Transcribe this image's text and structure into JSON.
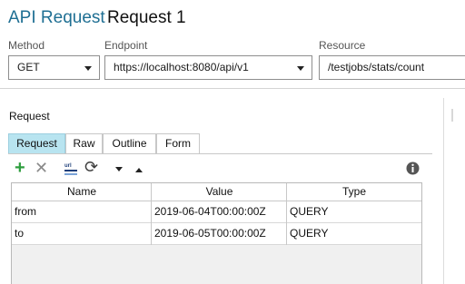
{
  "header": {
    "app_label": "API Request",
    "title": "Request 1"
  },
  "fields": {
    "method": {
      "label": "Method",
      "value": "GET"
    },
    "endpoint": {
      "label": "Endpoint",
      "value": "https://localhost:8080/api/v1"
    },
    "resource": {
      "label": "Resource",
      "value": "/testjobs/stats/count"
    }
  },
  "request_section": {
    "label": "Request",
    "tabs": [
      {
        "label": "Request",
        "active": true
      },
      {
        "label": "Raw",
        "active": false
      },
      {
        "label": "Outline",
        "active": false
      },
      {
        "label": "Form",
        "active": false
      }
    ]
  },
  "toolbar": {
    "icons": [
      "add-icon",
      "delete-icon",
      "url-encode-icon",
      "refresh-icon",
      "move-down-icon",
      "move-up-icon",
      "info-icon"
    ],
    "colors": {
      "add": "#2e9e3e",
      "delete": "#8a8a8a",
      "refresh": "#3c3c3c",
      "info": "#555555"
    }
  },
  "grid": {
    "columns": [
      "Name",
      "Value",
      "Type"
    ],
    "rows": [
      {
        "name": "from",
        "value": "2019-06-04T00:00:00Z",
        "type": "QUERY"
      },
      {
        "name": "to",
        "value": "2019-06-05T00:00:00Z",
        "type": "QUERY"
      }
    ]
  },
  "colors": {
    "accent": "#1f6f93",
    "active_tab": "#b8e4f0"
  }
}
